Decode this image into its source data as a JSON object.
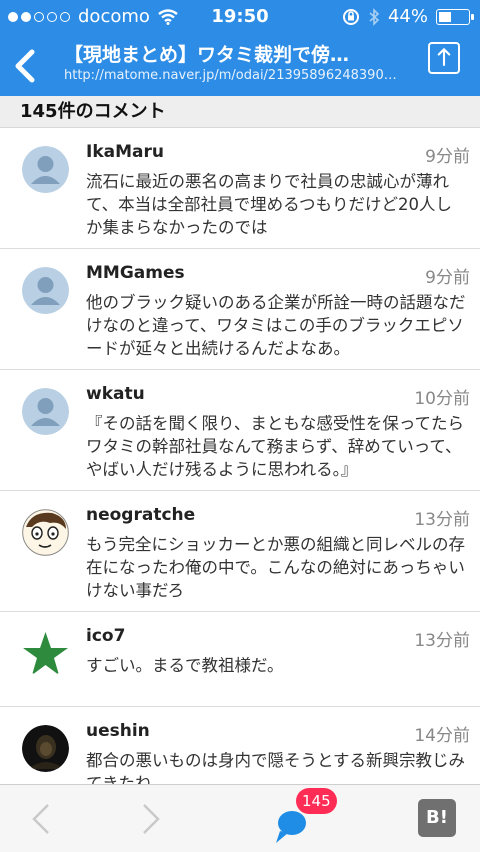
{
  "status_bar": {
    "signal_dots_filled": 2,
    "signal_dots_total": 5,
    "carrier": "docomo",
    "time": "19:50",
    "battery_percent": "44%",
    "battery_level": 0.44
  },
  "nav": {
    "title": "【現地まとめ】ワタミ裁判で傍…",
    "url": "http://matome.naver.jp/m/odai/213958962483907..."
  },
  "section_header": "145件のコメント",
  "comments": [
    {
      "name": "IkaMaru",
      "time": "9分前",
      "text": "流石に最近の悪名の高まりで社員の忠誠心が薄れて、本当は全部社員で埋めるつもりだけど20人しか集まらなかったのでは",
      "avatar": "default-avatar-icon"
    },
    {
      "name": "MMGames",
      "time": "9分前",
      "text": "他のブラック疑いのある企業が所詮一時の話題なだけなのと違って、ワタミはこの手のブラックエピソードが延々と出続けるんだよなあ。",
      "avatar": "default-avatar-icon"
    },
    {
      "name": "wkatu",
      "time": "10分前",
      "text": "『その話を聞く限り、まともな感受性を保ってたらワタミの幹部社員なんて務まらず、辞めていって、やばい人だけ残るように思われる。』",
      "avatar": "default-avatar-icon"
    },
    {
      "name": "neogratche",
      "time": "13分前",
      "text": "もう完全にショッカーとか悪の組織と同レベルの存在になったわ俺の中で。こんなの絶対にあっちゃいけない事だろ",
      "avatar": "cartoon-face-avatar"
    },
    {
      "name": "ico7",
      "time": "13分前",
      "text": "すごい。まるで教祖様だ。",
      "avatar": "green-star-avatar"
    },
    {
      "name": "ueshin",
      "time": "14分前",
      "text": "都合の悪いものは身内で隠そうとする新興宗教じみてきたね。",
      "avatar": "photo-avatar"
    }
  ],
  "toolbar": {
    "comment_count_badge": "145",
    "hatena_label": "B!"
  },
  "colors": {
    "header_blue": "#2d8de6",
    "comment_icon_blue": "#1f8ce6",
    "badge_pink": "#ff2d55",
    "star_green": "#2e8b3d"
  }
}
